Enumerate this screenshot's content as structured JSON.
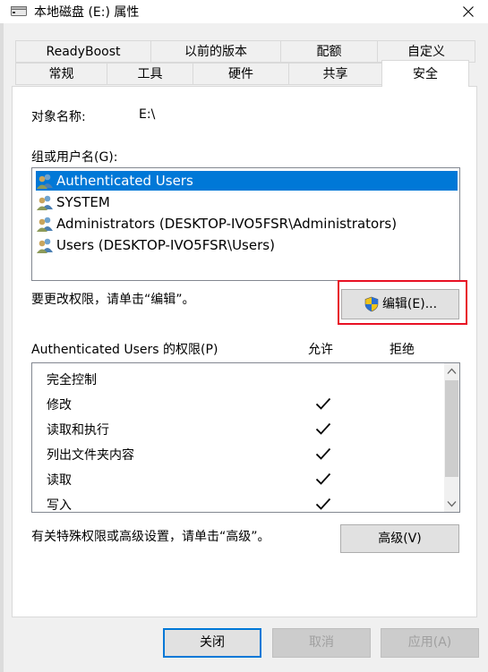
{
  "window": {
    "title": "本地磁盘 (E:) 属性"
  },
  "tabs_row1": [
    "ReadyBoost",
    "以前的版本",
    "配额",
    "自定义"
  ],
  "tabs_row2": [
    "常规",
    "工具",
    "硬件",
    "共享",
    "安全"
  ],
  "active_tab": "安全",
  "object_name_label": "对象名称:",
  "object_name_value": "E:\\",
  "groups_label": "组或用户名(G):",
  "users": [
    "Authenticated Users",
    "SYSTEM",
    "Administrators (DESKTOP-IVO5FSR\\Administrators)",
    "Users (DESKTOP-IVO5FSR\\Users)"
  ],
  "selected_user_index": 0,
  "change_hint": "要更改权限，请单击“编辑”。",
  "edit_button": "编辑(E)...",
  "permissions_label": "Authenticated Users 的权限(P)",
  "allow_header": "允许",
  "deny_header": "拒绝",
  "permissions": [
    {
      "name": "完全控制",
      "allow": false
    },
    {
      "name": "修改",
      "allow": true
    },
    {
      "name": "读取和执行",
      "allow": true
    },
    {
      "name": "列出文件夹内容",
      "allow": true
    },
    {
      "name": "读取",
      "allow": true
    },
    {
      "name": "写入",
      "allow": true
    }
  ],
  "advanced_hint": "有关特殊权限或高级设置，请单击“高级”。",
  "advanced_button": "高级(V)",
  "footer": {
    "close": "关闭",
    "cancel": "取消",
    "apply": "应用(A)"
  },
  "colors": {
    "selection": "#0078d7",
    "highlight": "#e81123"
  }
}
